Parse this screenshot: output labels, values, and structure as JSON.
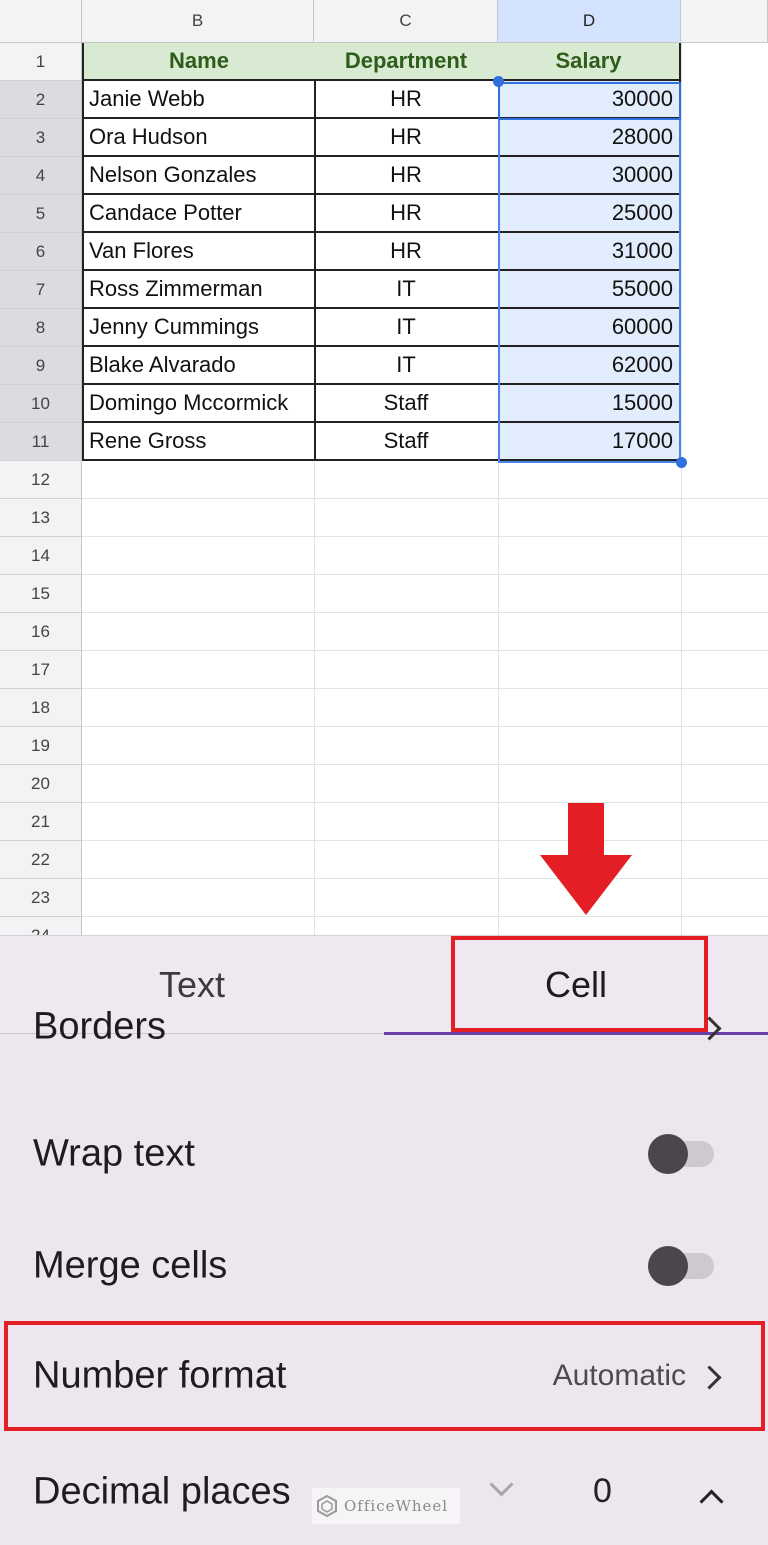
{
  "sheet": {
    "columns": [
      "B",
      "C",
      "D"
    ],
    "row_numbers": [
      "1",
      "2",
      "3",
      "4",
      "5",
      "6",
      "7",
      "8",
      "9",
      "10",
      "11",
      "12",
      "13",
      "14",
      "15",
      "16",
      "17",
      "18",
      "19",
      "20",
      "21",
      "22",
      "23",
      "24"
    ],
    "header": {
      "name": "Name",
      "department": "Department",
      "salary": "Salary"
    },
    "rows": [
      {
        "name": "Janie Webb",
        "department": "HR",
        "salary": "30000"
      },
      {
        "name": "Ora Hudson",
        "department": "HR",
        "salary": "28000"
      },
      {
        "name": "Nelson Gonzales",
        "department": "HR",
        "salary": "30000"
      },
      {
        "name": "Candace Potter",
        "department": "HR",
        "salary": "25000"
      },
      {
        "name": "Van Flores",
        "department": "HR",
        "salary": "31000"
      },
      {
        "name": "Ross Zimmerman",
        "department": "IT",
        "salary": "55000"
      },
      {
        "name": "Jenny Cummings",
        "department": "IT",
        "salary": "60000"
      },
      {
        "name": "Blake Alvarado",
        "department": "IT",
        "salary": "62000"
      },
      {
        "name": "Domingo Mccormick",
        "department": "Staff",
        "salary": "15000"
      },
      {
        "name": "Rene Gross",
        "department": "Staff",
        "salary": "17000"
      }
    ],
    "selected_column": "D",
    "selected_range": "D2:D11"
  },
  "panel": {
    "tabs": [
      {
        "label": "Text"
      },
      {
        "label": "Cell"
      }
    ],
    "active_tab": "Cell",
    "borders_label": "Borders",
    "wrap_text_label": "Wrap text",
    "wrap_text_on": false,
    "merge_cells_label": "Merge cells",
    "merge_cells_on": false,
    "number_format_label": "Number format",
    "number_format_value": "Automatic",
    "decimal_places_label": "Decimal places",
    "decimal_places_value": "0"
  },
  "watermark": "OfficeWheel",
  "colors": {
    "header_fill": "#d9ead3",
    "header_text": "#2e5d1a",
    "selection": "#4a86e8",
    "highlight_red": "#e41e25",
    "tab_underline": "#6a3fa6"
  },
  "icons": [
    "red-down-arrow-icon",
    "chevron-right-icon",
    "chevron-down-icon",
    "chevron-up-icon",
    "officewheel-logo-icon"
  ]
}
